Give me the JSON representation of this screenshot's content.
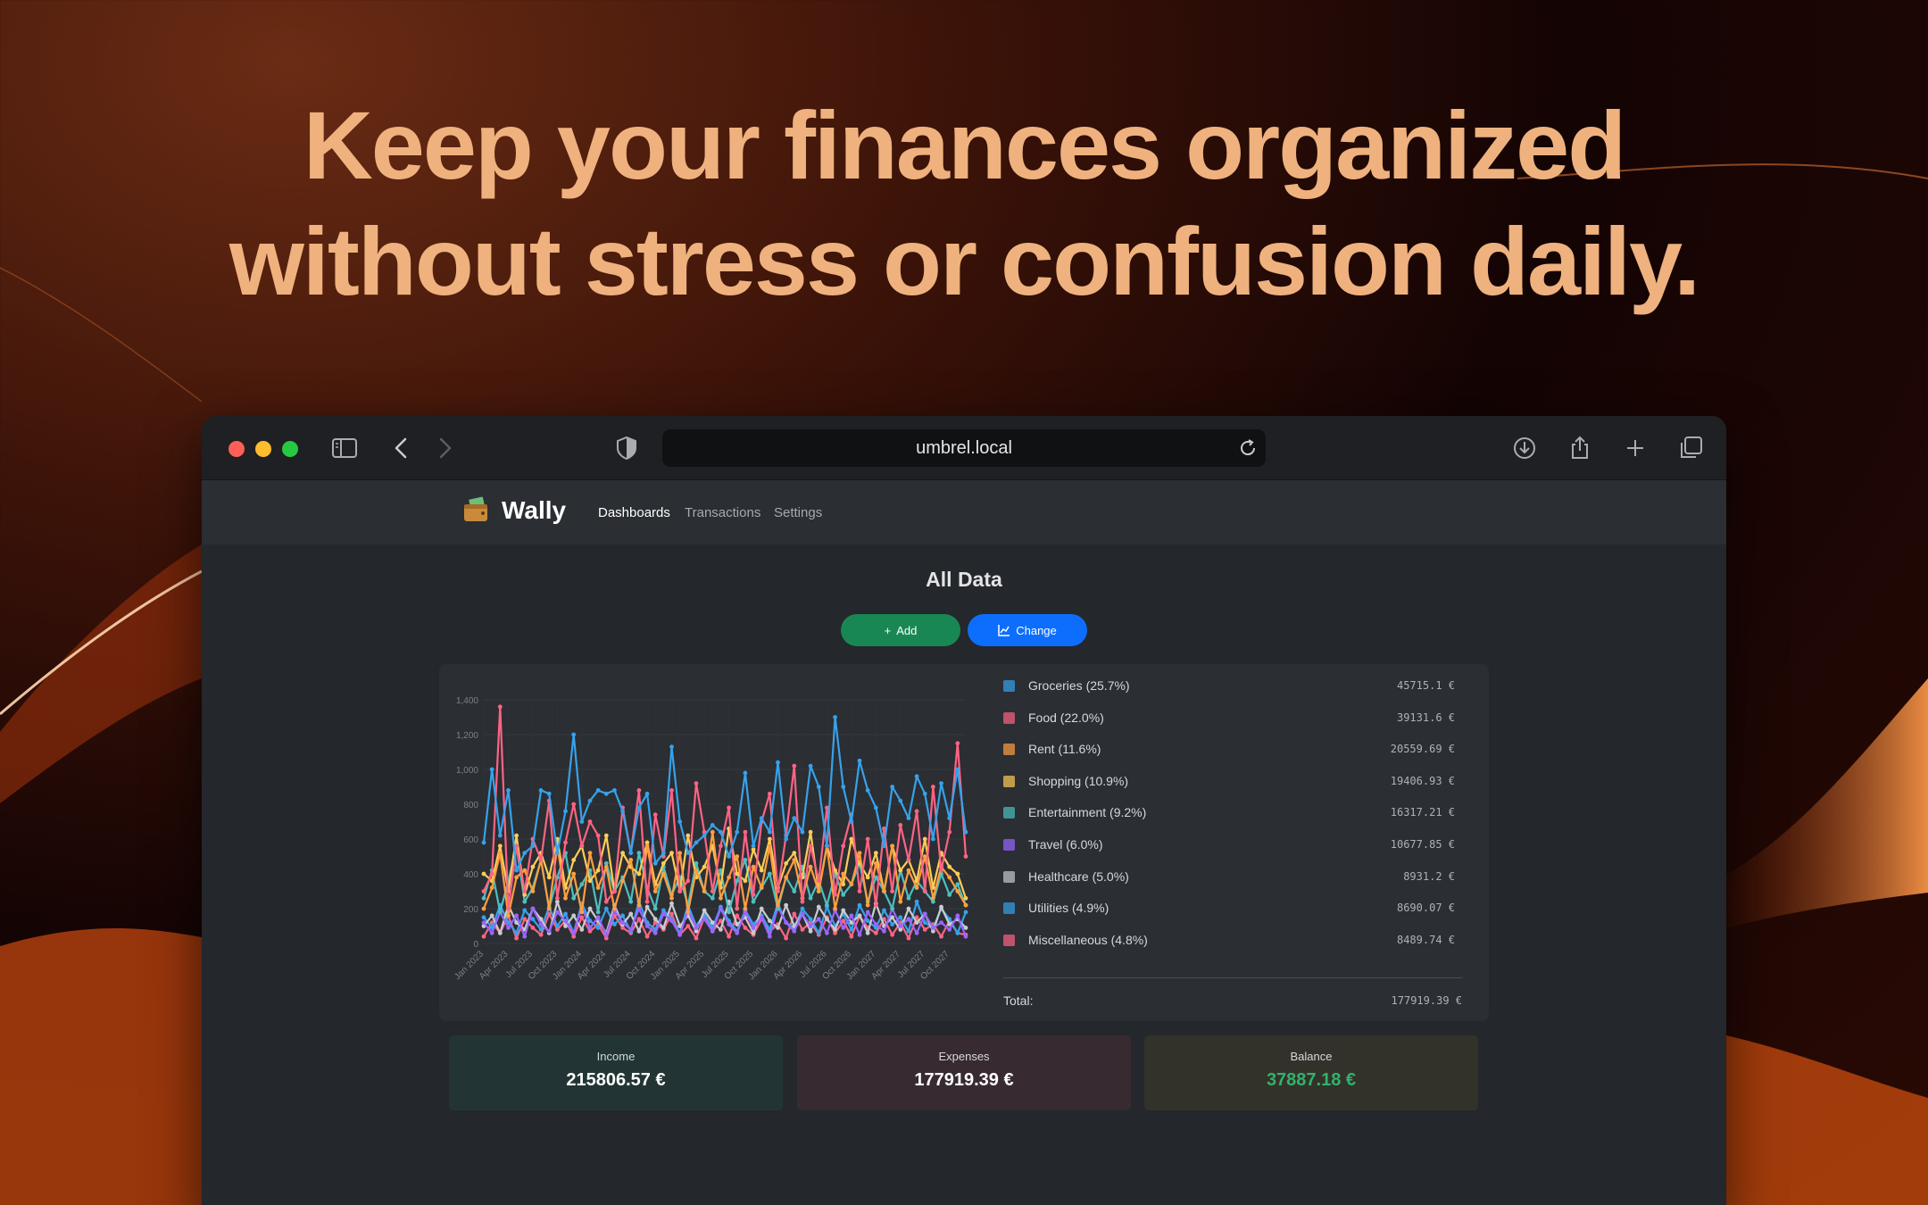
{
  "headline": {
    "line1": "Keep your finances organized",
    "line2": "without stress or confusion daily."
  },
  "browser": {
    "url": "umbrel.local"
  },
  "app": {
    "name": "Wally",
    "nav": [
      "Dashboards",
      "Transactions",
      "Settings"
    ],
    "active_nav": "Dashboards"
  },
  "page": {
    "title": "All Data",
    "add_label": "Add",
    "change_label": "Change"
  },
  "legend": {
    "items": [
      {
        "label": "Groceries (25.7%)",
        "amount": "45715.1 €",
        "color": "#36a2eb"
      },
      {
        "label": "Food (22.0%)",
        "amount": "39131.6 €",
        "color": "#ff6384"
      },
      {
        "label": "Rent (11.6%)",
        "amount": "20559.69 €",
        "color": "#ff9f40"
      },
      {
        "label": "Shopping (10.9%)",
        "amount": "19406.93 €",
        "color": "#ffcd56"
      },
      {
        "label": "Entertainment (9.2%)",
        "amount": "16317.21 €",
        "color": "#4bc0c0"
      },
      {
        "label": "Travel (6.0%)",
        "amount": "10677.85 €",
        "color": "#9966ff"
      },
      {
        "label": "Healthcare (5.0%)",
        "amount": "8931.2 €",
        "color": "#c9cbcf"
      },
      {
        "label": "Utilities (4.9%)",
        "amount": "8690.07 €",
        "color": "#36a2eb"
      },
      {
        "label": "Miscellaneous (4.8%)",
        "amount": "8489.74 €",
        "color": "#ff6384"
      }
    ],
    "total_label": "Total:",
    "total_amount": "177919.39 €"
  },
  "summary": {
    "income_label": "Income",
    "income_value": "215806.57 €",
    "expenses_label": "Expenses",
    "expenses_value": "177919.39 €",
    "balance_label": "Balance",
    "balance_value": "37887.18 €"
  },
  "chart_data": {
    "type": "line",
    "ylim": [
      0,
      1400
    ],
    "yticks": [
      "0",
      "200",
      "400",
      "600",
      "800",
      "1,000",
      "1,200",
      "1,400"
    ],
    "xtick_labels": [
      "Jan 2023",
      "Apr 2023",
      "Jul 2023",
      "Oct 2023",
      "Jan 2024",
      "Apr 2024",
      "Jul 2024",
      "Oct 2024",
      "Jan 2025",
      "Apr 2025",
      "Jul 2025",
      "Oct 2025",
      "Jan 2026",
      "Apr 2026",
      "Jul 2026",
      "Oct 2026",
      "Jan 2027",
      "Apr 2027",
      "Jul 2027",
      "Oct 2027"
    ],
    "months": 60,
    "series": [
      {
        "name": "Groceries",
        "color": "#36a2eb",
        "values": [
          580,
          1000,
          620,
          880,
          420,
          520,
          560,
          880,
          860,
          520,
          760,
          1200,
          700,
          820,
          880,
          860,
          880,
          760,
          520,
          780,
          860,
          460,
          520,
          1130,
          700,
          520,
          580,
          620,
          680,
          640,
          500,
          640,
          980,
          560,
          720,
          640,
          1040,
          600,
          720,
          640,
          1020,
          900,
          560,
          1300,
          900,
          700,
          1050,
          880,
          780,
          560,
          900,
          820,
          720,
          960,
          860,
          600,
          920,
          720,
          1000,
          640
        ]
      },
      {
        "name": "Food",
        "color": "#ff6384",
        "values": [
          300,
          400,
          1360,
          200,
          560,
          300,
          600,
          480,
          820,
          260,
          580,
          800,
          560,
          700,
          620,
          240,
          300,
          780,
          520,
          880,
          240,
          740,
          500,
          880,
          300,
          360,
          920,
          640,
          300,
          560,
          780,
          200,
          640,
          280,
          700,
          860,
          300,
          620,
          1020,
          240,
          560,
          360,
          780,
          280,
          560,
          740,
          300,
          600,
          220,
          660,
          300,
          680,
          480,
          760,
          300,
          900,
          420,
          640,
          1150,
          500
        ]
      },
      {
        "name": "Rent",
        "color": "#ff9f40",
        "values": [
          200,
          320,
          520,
          160,
          380,
          420,
          300,
          480,
          200,
          560,
          260,
          400,
          180,
          520,
          320,
          440,
          200,
          360,
          480,
          220,
          560,
          300,
          400,
          260,
          520,
          180,
          420,
          300,
          640,
          260,
          380,
          500,
          200,
          440,
          320,
          560,
          220,
          380,
          480,
          260,
          440,
          300,
          560,
          200,
          400,
          340,
          520,
          220,
          460,
          300,
          560,
          240,
          420,
          320,
          500,
          260,
          440,
          380,
          300,
          220
        ]
      },
      {
        "name": "Shopping",
        "color": "#ffcd56",
        "values": [
          400,
          360,
          560,
          300,
          620,
          280,
          440,
          520,
          380,
          600,
          320,
          480,
          560,
          360,
          420,
          620,
          300,
          520,
          440,
          400,
          580,
          340,
          460,
          520,
          300,
          620,
          380,
          440,
          560,
          320,
          660,
          400,
          360,
          540,
          420,
          600,
          320,
          460,
          520,
          380,
          640,
          300,
          560,
          420,
          340,
          600,
          460,
          380,
          520,
          300,
          560,
          420,
          480,
          360,
          600,
          320,
          520,
          440,
          400,
          260
        ]
      },
      {
        "name": "Entertainment",
        "color": "#4bc0c0",
        "values": [
          260,
          420,
          180,
          360,
          560,
          240,
          320,
          480,
          200,
          380,
          520,
          260,
          340,
          420,
          180,
          460,
          300,
          380,
          240,
          520,
          320,
          200,
          440,
          280,
          380,
          220,
          460,
          300,
          260,
          420,
          180,
          360,
          480,
          240,
          320,
          400,
          200,
          380,
          300,
          440,
          260,
          360,
          220,
          400,
          280,
          340,
          460,
          240,
          380,
          300,
          200,
          420,
          260,
          360,
          300,
          240,
          400,
          280,
          340,
          220
        ]
      },
      {
        "name": "Travel",
        "color": "#9966ff",
        "values": [
          120,
          60,
          180,
          90,
          160,
          40,
          200,
          110,
          70,
          180,
          130,
          60,
          210,
          90,
          150,
          50,
          190,
          120,
          80,
          200,
          100,
          60,
          170,
          130,
          50,
          190,
          90,
          140,
          70,
          200,
          110,
          60,
          180,
          90,
          150,
          40,
          210,
          120,
          70,
          170,
          100,
          140,
          60,
          190,
          90,
          160,
          50,
          180,
          110,
          70,
          200,
          100,
          140,
          60,
          170,
          90,
          120,
          80,
          160,
          40
        ]
      },
      {
        "name": "Healthcare",
        "color": "#c9cbcf",
        "values": [
          100,
          160,
          60,
          220,
          120,
          80,
          200,
          140,
          60,
          240,
          100,
          160,
          80,
          200,
          130,
          60,
          220,
          110,
          170,
          70,
          210,
          140,
          90,
          230,
          100,
          160,
          70,
          190,
          120,
          80,
          240,
          110,
          150,
          60,
          200,
          130,
          90,
          220,
          100,
          170,
          70,
          210,
          140,
          80,
          190,
          120,
          160,
          60,
          230,
          100,
          150,
          80,
          200,
          120,
          170,
          70,
          210,
          110,
          140,
          90
        ]
      },
      {
        "name": "Utilities",
        "color": "#36a2eb",
        "values": [
          150,
          90,
          220,
          120,
          60,
          190,
          140,
          80,
          210,
          100,
          170,
          60,
          230,
          130,
          90,
          200,
          110,
          160,
          70,
          240,
          120,
          80,
          190,
          140,
          60,
          220,
          100,
          170,
          90,
          210,
          130,
          70,
          190,
          110,
          160,
          80,
          230,
          120,
          90,
          200,
          140,
          60,
          210,
          100,
          170,
          80,
          220,
          130,
          90,
          190,
          110,
          150,
          70,
          240,
          120,
          90,
          200,
          140,
          60,
          180
        ]
      },
      {
        "name": "Miscellaneous",
        "color": "#ff6384",
        "values": [
          40,
          120,
          60,
          160,
          30,
          140,
          90,
          50,
          170,
          80,
          130,
          40,
          150,
          70,
          110,
          30,
          160,
          90,
          60,
          140,
          40,
          120,
          80,
          170,
          50,
          100,
          30,
          150,
          70,
          130,
          40,
          160,
          90,
          50,
          140,
          70,
          110,
          30,
          170,
          80,
          120,
          50,
          150,
          60,
          130,
          40,
          160,
          90,
          60,
          140,
          50,
          120,
          30,
          150,
          80,
          110,
          40,
          130,
          60,
          50
        ]
      }
    ]
  }
}
